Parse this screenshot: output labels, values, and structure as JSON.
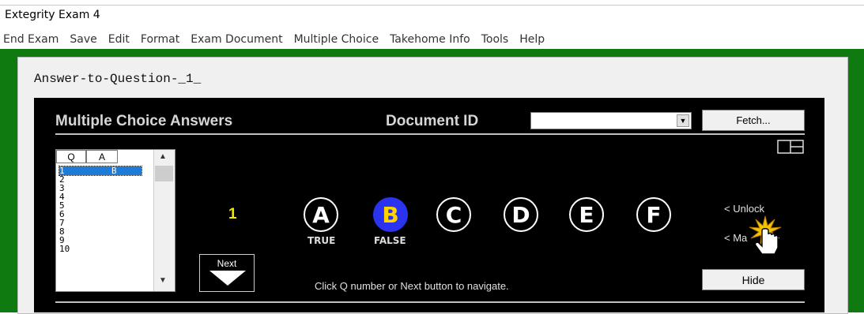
{
  "window": {
    "title": "Extegrity Exam 4"
  },
  "menu": [
    "End Exam",
    "Save",
    "Edit",
    "Format",
    "Exam Document",
    "Multiple Choice",
    "Takehome Info",
    "Tools",
    "Help"
  ],
  "document": {
    "title": "Answer-to-Question-_1_"
  },
  "mc": {
    "heading": "Multiple Choice Answers",
    "doc_id_label": "Document ID",
    "doc_id_value": "",
    "fetch_label": "Fetch...",
    "list_headers": [
      "Q",
      "A"
    ],
    "rows": [
      {
        "q": "1",
        "a": "B"
      },
      {
        "q": "2",
        "a": ""
      },
      {
        "q": "3",
        "a": ""
      },
      {
        "q": "4",
        "a": ""
      },
      {
        "q": "5",
        "a": ""
      },
      {
        "q": "6",
        "a": ""
      },
      {
        "q": "7",
        "a": ""
      },
      {
        "q": "8",
        "a": ""
      },
      {
        "q": "9",
        "a": ""
      },
      {
        "q": "10",
        "a": ""
      }
    ],
    "current_question": "1",
    "options": [
      "A",
      "B",
      "C",
      "D",
      "E",
      "F"
    ],
    "selected_option": "B",
    "true_label": "TRUE",
    "false_label": "FALSE",
    "next_label": "Next",
    "nav_hint": "Click Q number or Next button to navigate.",
    "unlock_label": "< Unlock",
    "mark_label": "< Ma",
    "hide_label": "Hide"
  },
  "colors": {
    "frame_green": "#0f7a0f",
    "selected_blue": "#2a34f0",
    "selected_letter": "#ffd400",
    "question_number": "#f2e600"
  },
  "icons": [
    "layout-grid-icon",
    "dropdown-arrow-icon",
    "down-triangle-icon",
    "hand-cursor-icon"
  ]
}
